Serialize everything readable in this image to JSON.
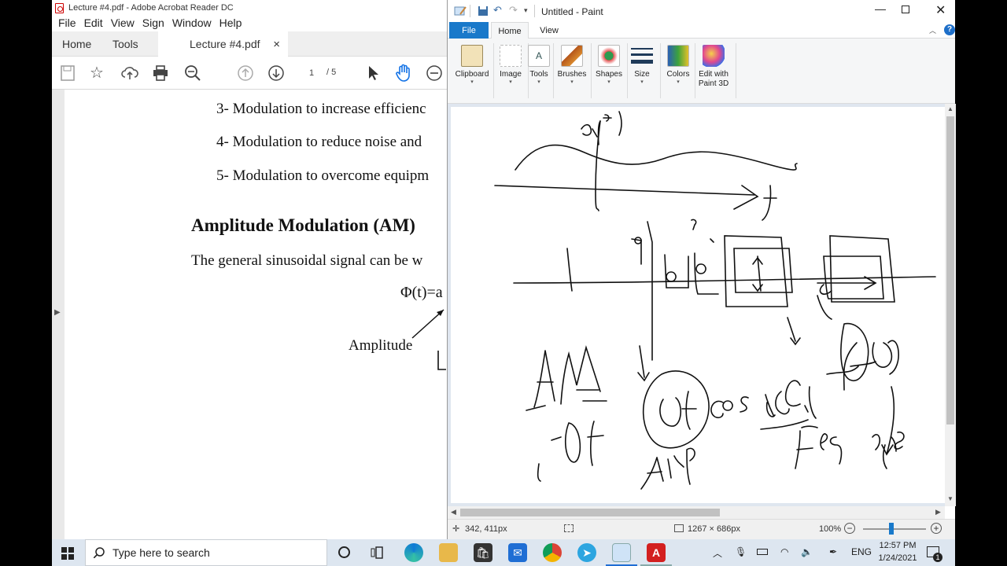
{
  "acrobat": {
    "title": "Lecture #4.pdf - Adobe Acrobat Reader DC",
    "menu": [
      "File",
      "Edit",
      "View",
      "Sign",
      "Window",
      "Help"
    ],
    "tabs": {
      "home": "Home",
      "tools": "Tools",
      "doc": "Lecture #4.pdf",
      "close": "×"
    },
    "page_current": "1",
    "page_total": "/ 5",
    "document": {
      "item3": "3-   Modulation  to increase  efficienc",
      "item4": "4-   Modulation  to reduce noise  and",
      "item5": "5-   Modulation  to overcome  equipm",
      "heading": "Amplitude Modulation (AM)",
      "paragraph": "The  general  sinusoidal  signal  can be w",
      "formula": "Φ(t)=a",
      "amplitude_label": "Amplitude"
    }
  },
  "paint": {
    "title": "Untitled - Paint",
    "ribbon_tabs": {
      "file": "File",
      "home": "Home",
      "view": "View"
    },
    "groups": [
      "Clipboard",
      "Image",
      "Tools",
      "Brushes",
      "Shapes",
      "Size",
      "Colors",
      "Edit with Paint 3D"
    ],
    "status": {
      "cursor": "342, 411px",
      "size": "1267 × 686px",
      "zoom": "100%"
    }
  },
  "taskbar": {
    "search_placeholder": "Type here to search",
    "language": "ENG",
    "time": "12:57 PM",
    "date": "1/24/2021",
    "notif_count": "1"
  }
}
